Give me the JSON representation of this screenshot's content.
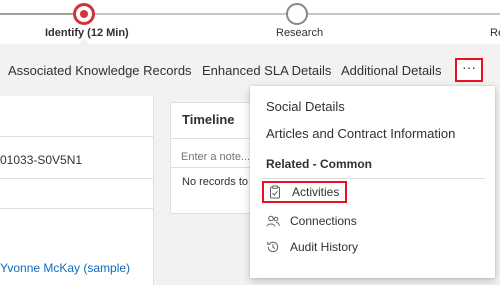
{
  "process": {
    "stages": [
      {
        "label": "Identify  (12 Min)",
        "state": "active"
      },
      {
        "label": "Research",
        "state": "pending"
      },
      {
        "label": "Re",
        "state": "pending"
      }
    ]
  },
  "tabs": [
    "Associated Knowledge Records",
    "Enhanced SLA Details",
    "Additional Details"
  ],
  "more_button": {
    "label": "···"
  },
  "form": {
    "case_number": "01033-S0V5N1",
    "customer": "Yvonne McKay (sample)"
  },
  "timeline": {
    "title": "Timeline",
    "note_placeholder": "Enter a note...",
    "empty_text": "No records to"
  },
  "menu": {
    "items": [
      "Social Details",
      "Articles and Contract Information"
    ],
    "group_heading": "Related - Common",
    "related": [
      {
        "label": "Activities",
        "icon": "clipboard-icon",
        "highlighted": true
      },
      {
        "label": "Connections",
        "icon": "people-icon",
        "highlighted": false
      },
      {
        "label": "Audit History",
        "icon": "history-icon",
        "highlighted": false
      }
    ]
  },
  "colors": {
    "active_stage": "#d13438",
    "highlight_outline": "#e81123",
    "link": "#0f6cbd",
    "background": "#f3f2f1"
  }
}
